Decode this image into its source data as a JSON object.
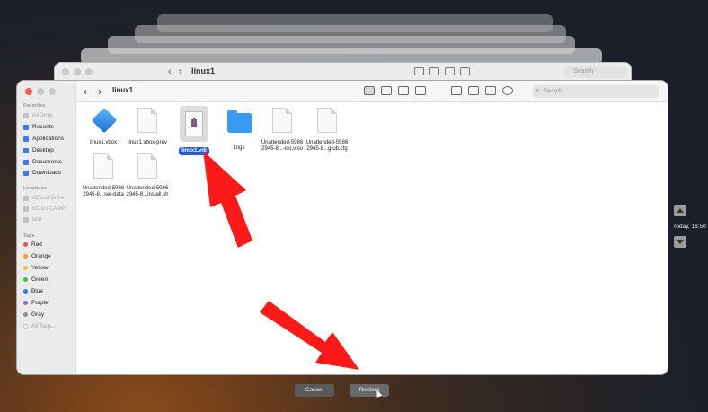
{
  "back_window": {
    "title": "linux1",
    "search_placeholder": "Search"
  },
  "finder": {
    "title": "linux1",
    "search_placeholder": "Search",
    "sidebar": {
      "favorites_heading": "Favorites",
      "favorites": [
        {
          "label": "AirDrop",
          "icon": "airdrop-icon",
          "dim": true
        },
        {
          "label": "Recents",
          "icon": "clock-icon"
        },
        {
          "label": "Applications",
          "icon": "applications-icon"
        },
        {
          "label": "Desktop",
          "icon": "desktop-icon"
        },
        {
          "label": "Documents",
          "icon": "document-icon"
        },
        {
          "label": "Downloads",
          "icon": "downloads-icon"
        }
      ],
      "locations_heading": "Locations",
      "locations": [
        {
          "label": "iCloud Drive",
          "icon": "cloud-icon"
        },
        {
          "label": "BOOTCAMP",
          "icon": "disk-icon"
        },
        {
          "label": "test",
          "icon": "disk-icon"
        }
      ],
      "tags_heading": "Tags",
      "tags": [
        {
          "label": "Red",
          "color": "#ff4a4a"
        },
        {
          "label": "Orange",
          "color": "#ff9a2e"
        },
        {
          "label": "Yellow",
          "color": "#f5c825"
        },
        {
          "label": "Green",
          "color": "#3cc24a"
        },
        {
          "label": "Blue",
          "color": "#2f7cf6"
        },
        {
          "label": "Purple",
          "color": "#a25ad9"
        },
        {
          "label": "Gray",
          "color": "#8e8e8e"
        },
        {
          "label": "All Tags...",
          "color": "#bdbdbd"
        }
      ]
    },
    "files": [
      {
        "name": "linux1.vbox",
        "type": "vbox"
      },
      {
        "name": "linux1.vbox-prev",
        "type": "doc"
      },
      {
        "name": "linux1.vdi",
        "type": "vdi",
        "selected": true
      },
      {
        "name": "Logs",
        "type": "folder"
      },
      {
        "name": "Unattended-5986 2945-8...-iso.viso",
        "type": "doc"
      },
      {
        "name": "Unattended-5986 2945-8...grub.cfg",
        "type": "doc"
      },
      {
        "name": "Unattended-5986 2945-8...ser-data",
        "type": "doc"
      },
      {
        "name": "Unattended-5986 2945-8...install.sh",
        "type": "shell"
      }
    ]
  },
  "time_machine": {
    "timestamp": "Today, 16:50"
  },
  "buttons": {
    "cancel": "Cancel",
    "restore": "Restore"
  },
  "accent": "#ff1a1a"
}
